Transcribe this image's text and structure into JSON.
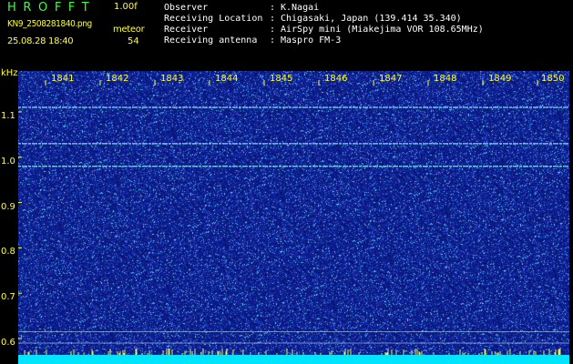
{
  "colors": {
    "title": "#3cff3c",
    "accent_yellow": "#ffff3c",
    "info_white": "#ffffff",
    "waterfall_bg": "#0b1a86",
    "noise_light": "#6fd6ff",
    "noise_mid": "#3a6ee6",
    "signal_line": "#8ff0ff",
    "bottom_band": "#00e5ff"
  },
  "header": {
    "title": "HROFFT",
    "version": "1.00f",
    "filename": "KN9_2508281840.png",
    "meteor_label": "meteor",
    "datetime": "25.08.28 18:40",
    "meteor_count": "54",
    "info": [
      {
        "label": "Observer",
        "sep": ":",
        "value": "K.Nagai"
      },
      {
        "label": "Receiving Location",
        "sep": ":",
        "value": "Chigasaki, Japan (139.414 35.340)"
      },
      {
        "label": "Receiver",
        "sep": ":",
        "value": "AirSpy mini (Miakejima VOR 108.65MHz)"
      },
      {
        "label": "Receiving antenna",
        "sep": ":",
        "value": "Maspro FM-3"
      }
    ]
  },
  "spectrogram": {
    "unit_label": "kHz",
    "y_ticks": [
      "1.1",
      "1.0",
      "0.9",
      "0.8",
      "0.7",
      "0.6"
    ],
    "y_values": [
      1.1,
      1.0,
      0.9,
      0.8,
      0.7,
      0.6
    ],
    "x_ticks": [
      "1841",
      "1842",
      "1843",
      "1844",
      "1845",
      "1846",
      "1847",
      "1848",
      "1849",
      "1850"
    ],
    "y_range": [
      0.58,
      1.23
    ],
    "signal_lines_khz": [
      1.11,
      1.03,
      0.98
    ],
    "faint_lines_khz": [
      0.615,
      0.59
    ]
  }
}
